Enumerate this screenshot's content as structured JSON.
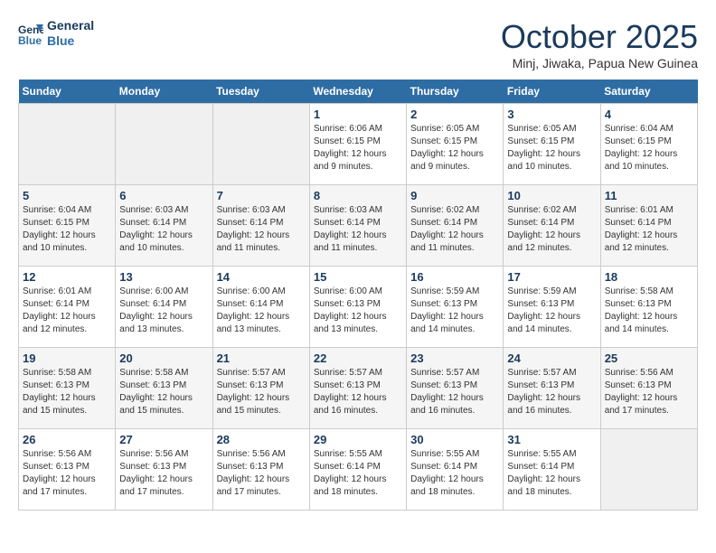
{
  "header": {
    "logo_line1": "General",
    "logo_line2": "Blue",
    "month": "October 2025",
    "location": "Minj, Jiwaka, Papua New Guinea"
  },
  "weekdays": [
    "Sunday",
    "Monday",
    "Tuesday",
    "Wednesday",
    "Thursday",
    "Friday",
    "Saturday"
  ],
  "weeks": [
    [
      {
        "day": "",
        "info": ""
      },
      {
        "day": "",
        "info": ""
      },
      {
        "day": "",
        "info": ""
      },
      {
        "day": "1",
        "info": "Sunrise: 6:06 AM\nSunset: 6:15 PM\nDaylight: 12 hours\nand 9 minutes."
      },
      {
        "day": "2",
        "info": "Sunrise: 6:05 AM\nSunset: 6:15 PM\nDaylight: 12 hours\nand 9 minutes."
      },
      {
        "day": "3",
        "info": "Sunrise: 6:05 AM\nSunset: 6:15 PM\nDaylight: 12 hours\nand 10 minutes."
      },
      {
        "day": "4",
        "info": "Sunrise: 6:04 AM\nSunset: 6:15 PM\nDaylight: 12 hours\nand 10 minutes."
      }
    ],
    [
      {
        "day": "5",
        "info": "Sunrise: 6:04 AM\nSunset: 6:15 PM\nDaylight: 12 hours\nand 10 minutes."
      },
      {
        "day": "6",
        "info": "Sunrise: 6:03 AM\nSunset: 6:14 PM\nDaylight: 12 hours\nand 10 minutes."
      },
      {
        "day": "7",
        "info": "Sunrise: 6:03 AM\nSunset: 6:14 PM\nDaylight: 12 hours\nand 11 minutes."
      },
      {
        "day": "8",
        "info": "Sunrise: 6:03 AM\nSunset: 6:14 PM\nDaylight: 12 hours\nand 11 minutes."
      },
      {
        "day": "9",
        "info": "Sunrise: 6:02 AM\nSunset: 6:14 PM\nDaylight: 12 hours\nand 11 minutes."
      },
      {
        "day": "10",
        "info": "Sunrise: 6:02 AM\nSunset: 6:14 PM\nDaylight: 12 hours\nand 12 minutes."
      },
      {
        "day": "11",
        "info": "Sunrise: 6:01 AM\nSunset: 6:14 PM\nDaylight: 12 hours\nand 12 minutes."
      }
    ],
    [
      {
        "day": "12",
        "info": "Sunrise: 6:01 AM\nSunset: 6:14 PM\nDaylight: 12 hours\nand 12 minutes."
      },
      {
        "day": "13",
        "info": "Sunrise: 6:00 AM\nSunset: 6:14 PM\nDaylight: 12 hours\nand 13 minutes."
      },
      {
        "day": "14",
        "info": "Sunrise: 6:00 AM\nSunset: 6:14 PM\nDaylight: 12 hours\nand 13 minutes."
      },
      {
        "day": "15",
        "info": "Sunrise: 6:00 AM\nSunset: 6:13 PM\nDaylight: 12 hours\nand 13 minutes."
      },
      {
        "day": "16",
        "info": "Sunrise: 5:59 AM\nSunset: 6:13 PM\nDaylight: 12 hours\nand 14 minutes."
      },
      {
        "day": "17",
        "info": "Sunrise: 5:59 AM\nSunset: 6:13 PM\nDaylight: 12 hours\nand 14 minutes."
      },
      {
        "day": "18",
        "info": "Sunrise: 5:58 AM\nSunset: 6:13 PM\nDaylight: 12 hours\nand 14 minutes."
      }
    ],
    [
      {
        "day": "19",
        "info": "Sunrise: 5:58 AM\nSunset: 6:13 PM\nDaylight: 12 hours\nand 15 minutes."
      },
      {
        "day": "20",
        "info": "Sunrise: 5:58 AM\nSunset: 6:13 PM\nDaylight: 12 hours\nand 15 minutes."
      },
      {
        "day": "21",
        "info": "Sunrise: 5:57 AM\nSunset: 6:13 PM\nDaylight: 12 hours\nand 15 minutes."
      },
      {
        "day": "22",
        "info": "Sunrise: 5:57 AM\nSunset: 6:13 PM\nDaylight: 12 hours\nand 16 minutes."
      },
      {
        "day": "23",
        "info": "Sunrise: 5:57 AM\nSunset: 6:13 PM\nDaylight: 12 hours\nand 16 minutes."
      },
      {
        "day": "24",
        "info": "Sunrise: 5:57 AM\nSunset: 6:13 PM\nDaylight: 12 hours\nand 16 minutes."
      },
      {
        "day": "25",
        "info": "Sunrise: 5:56 AM\nSunset: 6:13 PM\nDaylight: 12 hours\nand 17 minutes."
      }
    ],
    [
      {
        "day": "26",
        "info": "Sunrise: 5:56 AM\nSunset: 6:13 PM\nDaylight: 12 hours\nand 17 minutes."
      },
      {
        "day": "27",
        "info": "Sunrise: 5:56 AM\nSunset: 6:13 PM\nDaylight: 12 hours\nand 17 minutes."
      },
      {
        "day": "28",
        "info": "Sunrise: 5:56 AM\nSunset: 6:13 PM\nDaylight: 12 hours\nand 17 minutes."
      },
      {
        "day": "29",
        "info": "Sunrise: 5:55 AM\nSunset: 6:14 PM\nDaylight: 12 hours\nand 18 minutes."
      },
      {
        "day": "30",
        "info": "Sunrise: 5:55 AM\nSunset: 6:14 PM\nDaylight: 12 hours\nand 18 minutes."
      },
      {
        "day": "31",
        "info": "Sunrise: 5:55 AM\nSunset: 6:14 PM\nDaylight: 12 hours\nand 18 minutes."
      },
      {
        "day": "",
        "info": ""
      }
    ]
  ]
}
